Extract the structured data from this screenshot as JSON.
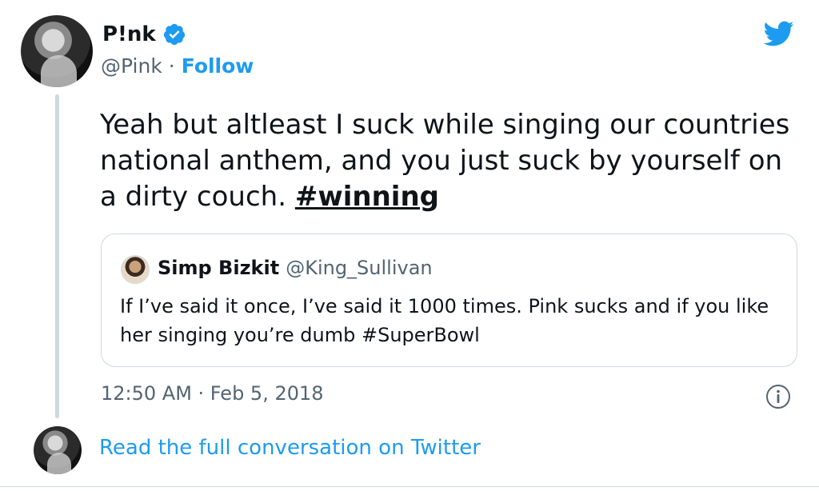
{
  "author": {
    "display_name": "P!nk",
    "handle": "@Pink",
    "separator": "·",
    "follow_label": "Follow",
    "verified": true
  },
  "tweet": {
    "text": "Yeah but altleast I suck while singing our countries national anthem, and you just suck by yourself on a dirty couch.",
    "hashtag": "#winning",
    "timestamp": "12:50 AM · Feb 5, 2018"
  },
  "quoted_tweet": {
    "display_name": "Simp Bizkit",
    "handle": "@King_Sullivan",
    "text": "If I’ve said it once, I’ve said it 1000 times. Pink sucks and if you like her singing you’re dumb #SuperBowl"
  },
  "footer": {
    "read_more_label": "Read the full conversation on Twitter"
  },
  "icons": {
    "verified": "verified-badge-icon",
    "brand": "twitter-bird-icon",
    "info": "info-icon"
  },
  "colors": {
    "accent": "#1d9bf0",
    "text": "#0f1419",
    "muted": "#536471",
    "border": "#cfd9de"
  }
}
